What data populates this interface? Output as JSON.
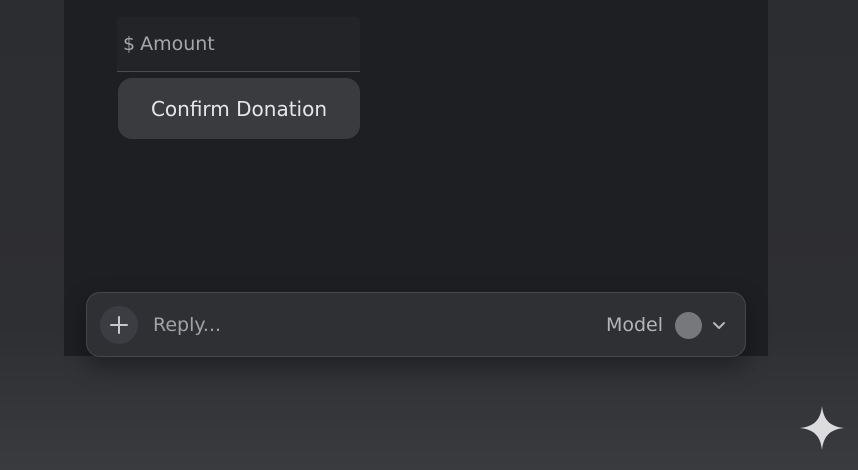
{
  "donation_form": {
    "amount_currency": "$",
    "amount_placeholder": "Amount",
    "confirm_label": "Confirm Donation"
  },
  "composer": {
    "reply_placeholder": "Reply...",
    "model_label": "Model",
    "icons": {
      "add": "plus-icon",
      "model_status": "circle-dot",
      "dropdown": "chevron-down-icon"
    }
  },
  "watermark": {
    "icon": "sparkle-icon"
  }
}
